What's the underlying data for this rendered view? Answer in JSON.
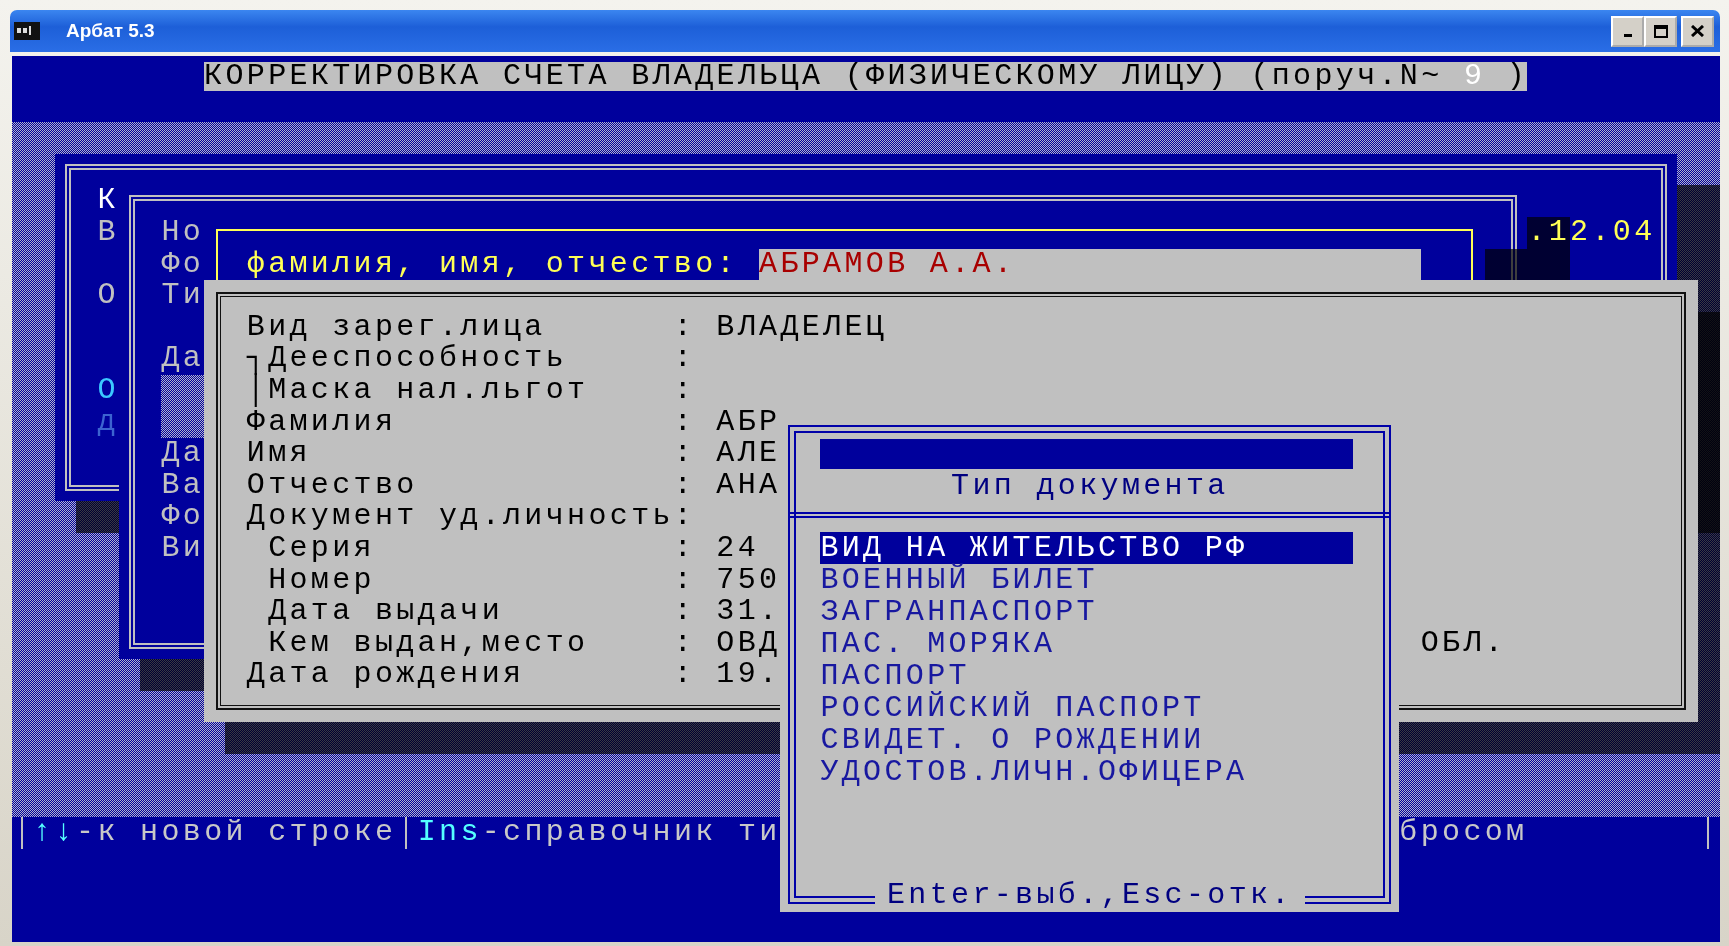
{
  "window": {
    "title": "Арбат 5.3"
  },
  "header": {
    "title": "КОРРЕКТИРОВКА СЧЕТА ВЛАДЕЛЬЦА (ФИЗИЧЕСКОМУ ЛИЦУ) (поруч.N~",
    "order_number": "9",
    "closing": ")"
  },
  "back_window": {
    "letters": [
      {
        "text": "К",
        "kind": "title"
      },
      {
        "text": "В",
        "kind": "label"
      },
      {
        "text": "О",
        "kind": "label"
      },
      {
        "text": "О",
        "kind": "highlight"
      },
      {
        "text": "д",
        "kind": "dim"
      }
    ],
    "date": ".12.04"
  },
  "middle_window": {
    "labels": [
      "Но",
      "Фо",
      "Ти",
      "Да",
      "Да",
      "Ва",
      "Фо",
      "Ви"
    ]
  },
  "name_window": {
    "label": "фамилия, имя, отчество:",
    "value": "АБРАМОВ А.А."
  },
  "details": {
    "rows": [
      {
        "label": "Вид зарег.лица",
        "colon": ":",
        "value": "ВЛАДЕЛЕЦ"
      },
      {
        "label": "┐Дееспособность",
        "colon": ":"
      },
      {
        "label": "│Маска нал.льгот",
        "colon": ":"
      },
      {
        "label": "Фамилия",
        "colon": ":",
        "value": "АБР"
      },
      {
        "label": "Имя",
        "colon": ":",
        "value": "АЛЕ"
      },
      {
        "label": "Отчество",
        "colon": ":",
        "value": "АНА"
      },
      {
        "label": "Документ уд.личность",
        "colon": ":",
        "children": [
          {
            "label": "Серия",
            "colon": ":",
            "value": "24"
          },
          {
            "label": "Номер",
            "colon": ":",
            "value": "750"
          },
          {
            "label": "Дата выдачи",
            "colon": ":",
            "value": "31."
          },
          {
            "label": "Кем выдан,место",
            "colon": ":",
            "value": "ОВД",
            "extra": "ОБЛ."
          }
        ]
      },
      {
        "label": "Дата рождения",
        "colon": ":",
        "value": "19."
      }
    ]
  },
  "popup": {
    "title": "Тип документа",
    "items": [
      {
        "label": "ВИД НА ЖИТЕЛЬСТВО РФ",
        "selected": true
      },
      {
        "label": "ВОЕННЫЙ БИЛЕТ",
        "selected": false
      },
      {
        "label": "ЗАГРАНПАСПОРТ",
        "selected": false
      },
      {
        "label": "ПАС. МОРЯКА",
        "selected": false
      },
      {
        "label": "ПАСПОРТ",
        "selected": false
      },
      {
        "label": "РОССИЙСКИЙ ПАСПОРТ",
        "selected": false
      },
      {
        "label": "СВИДЕТ. О РОЖДЕНИИ",
        "selected": false
      },
      {
        "label": "УДОСТОВ.ЛИЧН.ОФИЦЕРА",
        "selected": false
      }
    ],
    "footer": "Enter-выб.,Esc-отк."
  },
  "status_bar": {
    "hints": [
      {
        "key": "↑↓",
        "text": "-к новой строке"
      },
      {
        "key": "Ins",
        "text": "-справочник ти"
      }
    ],
    "tail": "бросом"
  }
}
